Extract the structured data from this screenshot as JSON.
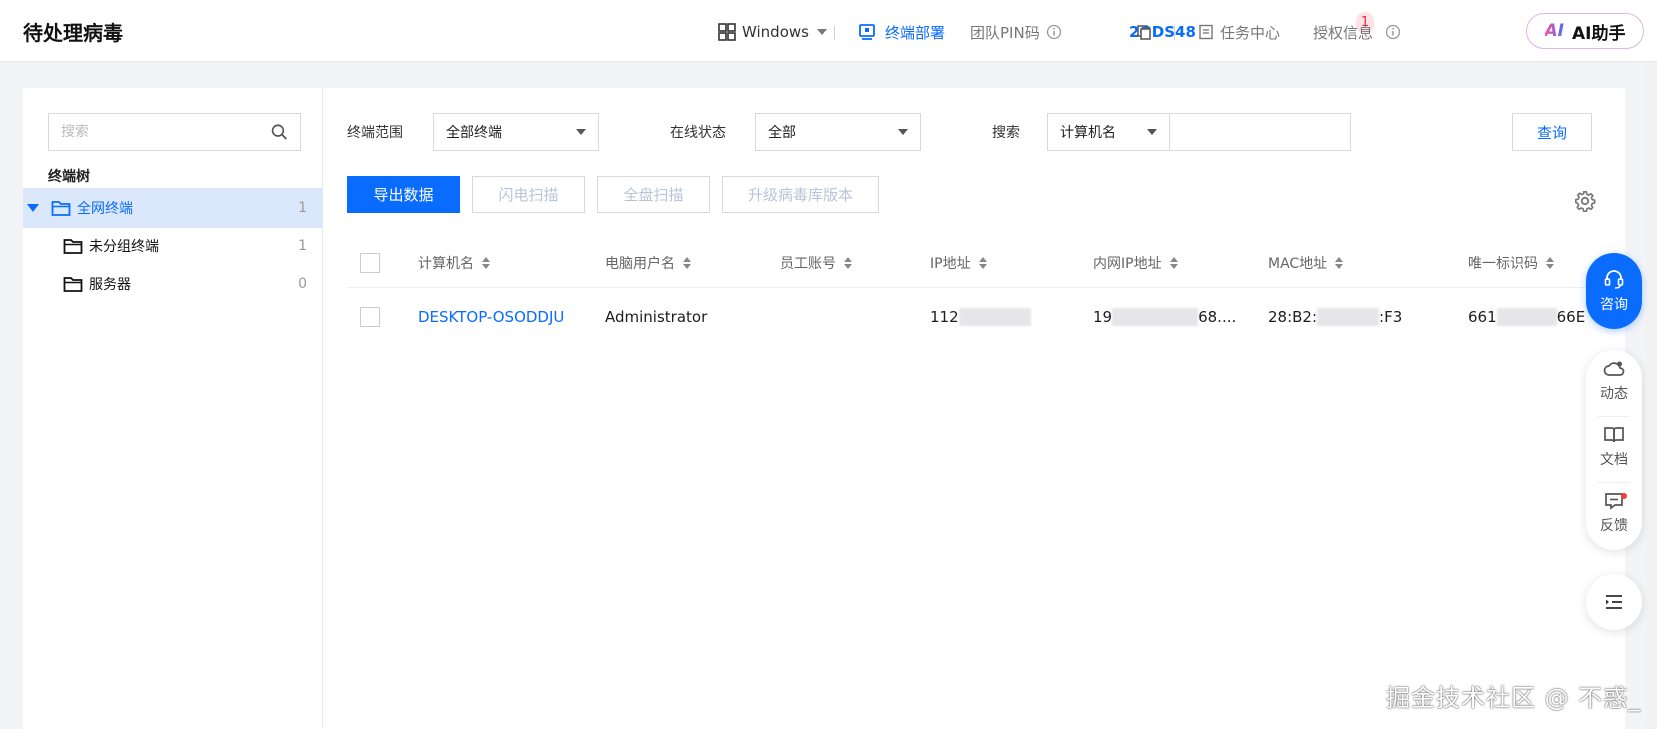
{
  "header": {
    "title": "待处理病毒",
    "os_label": "Windows",
    "deploy_label": "终端部署",
    "pin_label": "团队PIN码",
    "pin_value": "2GDS48",
    "task_label": "任务中心",
    "task_badge": "1",
    "license_label": "授权信息",
    "ai_label": "AI助手",
    "ai_logo": "AI"
  },
  "sidebar": {
    "search_placeholder": "搜索",
    "tree_title": "终端树",
    "items": [
      {
        "label": "全网终端",
        "count": "1",
        "selected": true
      },
      {
        "label": "未分组终端",
        "count": "1"
      },
      {
        "label": "服务器",
        "count": "0"
      }
    ]
  },
  "filters": {
    "scope_label": "终端范围",
    "scope_value": "全部终端",
    "status_label": "在线状态",
    "status_value": "全部",
    "search_label": "搜索",
    "search_field": "计算机名",
    "search_value": "",
    "query_label": "查询"
  },
  "actions": {
    "export": "导出数据",
    "flash_scan": "闪电扫描",
    "full_scan": "全盘扫描",
    "upgrade": "升级病毒库版本"
  },
  "table": {
    "columns": [
      "计算机名",
      "电脑用户名",
      "员工账号",
      "IP地址",
      "内网IP地址",
      "MAC地址",
      "唯一标识码"
    ],
    "rows": [
      {
        "computer": "DESKTOP-OSODDJU",
        "user": "Administrator",
        "employee": "",
        "ip_prefix": "112",
        "lan_ip_prefix": "19",
        "lan_ip_suffix": "68....",
        "mac_prefix": "28:B2:",
        "mac_suffix": ":F3",
        "uid_prefix": "661",
        "uid_suffix": "66E"
      }
    ]
  },
  "float": {
    "consult": "咨询",
    "dynamics": "动态",
    "docs": "文档",
    "feedback": "反馈"
  },
  "watermark": "掘金技术社区 @ 不惑_",
  "colors": {
    "accent": "#0a6cff",
    "selected_bg": "#dbe7fb",
    "badge_red": "#f23c3c"
  }
}
